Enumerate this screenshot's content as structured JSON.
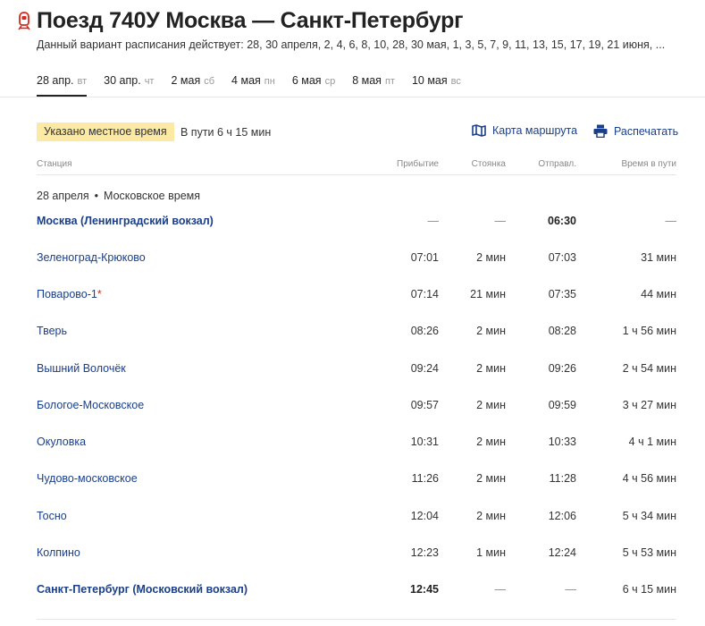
{
  "header": {
    "title": "Поезд 740У Москва — Санкт-Петербург",
    "schedule_note": "Данный вариант расписания действует: 28, 30 апреля, 2, 4, 6, 8, 10, 28, 30 мая, 1, 3, 5, 7, 9, 11, 13, 15, 17, 19, 21 июня, ..."
  },
  "date_tabs": [
    {
      "date": "28 апр.",
      "dow": "вт",
      "active": true
    },
    {
      "date": "30 апр.",
      "dow": "чт",
      "active": false
    },
    {
      "date": "2 мая",
      "dow": "сб",
      "active": false
    },
    {
      "date": "4 мая",
      "dow": "пн",
      "active": false
    },
    {
      "date": "6 мая",
      "dow": "ср",
      "active": false
    },
    {
      "date": "8 мая",
      "dow": "пт",
      "active": false
    },
    {
      "date": "10 мая",
      "dow": "вс",
      "active": false
    }
  ],
  "info": {
    "local_time_badge": "Указано местное время",
    "duration": "В пути 6 ч 15 мин"
  },
  "actions": {
    "map_label": "Карта маршрута",
    "print_label": "Распечатать"
  },
  "columns": {
    "station": "Станция",
    "arrival": "Прибытие",
    "stop": "Стоянка",
    "departure": "Отправл.",
    "total": "Время в пути"
  },
  "date_group": {
    "date": "28 апреля",
    "separator": "•",
    "timezone": "Московское время"
  },
  "stations": [
    {
      "name": "Москва (Ленинградский вокзал)",
      "arrival": "—",
      "stop": "—",
      "departure": "06:30",
      "total": "—",
      "bold": true
    },
    {
      "name": "Зеленоград-Крюково",
      "arrival": "07:01",
      "stop": "2 мин",
      "departure": "07:03",
      "total": "31 мин"
    },
    {
      "name": "Поварово-1",
      "asterisk": "*",
      "arrival": "07:14",
      "stop": "21 мин",
      "departure": "07:35",
      "total": "44 мин"
    },
    {
      "name": "Тверь",
      "arrival": "08:26",
      "stop": "2 мин",
      "departure": "08:28",
      "total": "1 ч 56 мин"
    },
    {
      "name": "Вышний Волочёк",
      "arrival": "09:24",
      "stop": "2 мин",
      "departure": "09:26",
      "total": "2 ч 54 мин"
    },
    {
      "name": "Бологое-Московское",
      "arrival": "09:57",
      "stop": "2 мин",
      "departure": "09:59",
      "total": "3 ч 27 мин"
    },
    {
      "name": "Окуловка",
      "arrival": "10:31",
      "stop": "2 мин",
      "departure": "10:33",
      "total": "4 ч 1 мин"
    },
    {
      "name": "Чудово-московское",
      "arrival": "11:26",
      "stop": "2 мин",
      "departure": "11:28",
      "total": "4 ч 56 мин"
    },
    {
      "name": "Тосно",
      "arrival": "12:04",
      "stop": "2 мин",
      "departure": "12:06",
      "total": "5 ч 34 мин"
    },
    {
      "name": "Колпино",
      "arrival": "12:23",
      "stop": "1 мин",
      "departure": "12:24",
      "total": "5 ч 53 мин"
    },
    {
      "name": "Санкт-Петербург (Московский вокзал)",
      "arrival": "12:45",
      "stop": "—",
      "departure": "—",
      "total": "6 ч 15 мин",
      "bold": true
    }
  ],
  "icons": {
    "train": "train-icon",
    "map": "map-icon",
    "print": "printer-icon"
  },
  "colors": {
    "link": "#1a3f8a",
    "badge_bg": "#fbe9a4",
    "brand_red": "#d6281e"
  }
}
